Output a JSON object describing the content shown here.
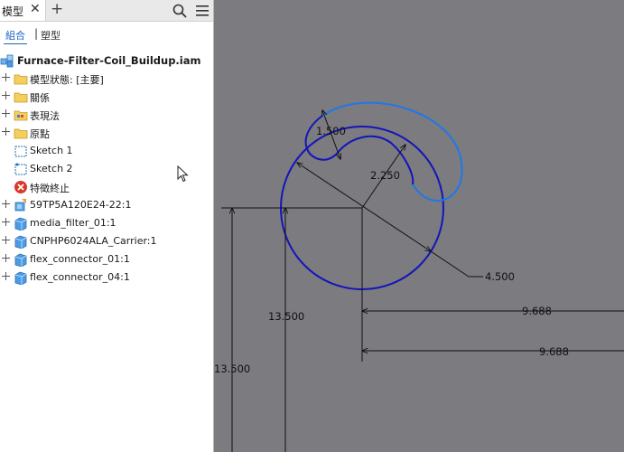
{
  "tabs": {
    "model_label": "模型",
    "close_glyph": "✕",
    "add_glyph": "+"
  },
  "icons": {
    "search": "search-icon",
    "menu": "hamburger-menu-icon",
    "assembly": "assembly-icon",
    "folder": "folder-icon",
    "sketch": "sketch-icon",
    "end_of_features": "end-of-features-icon",
    "part": "part-icon"
  },
  "subtabs": {
    "assembly": "組合",
    "separator": "|",
    "modeling": "塑型"
  },
  "tree": {
    "root": "Furnace-Filter-Coil_Buildup.iam",
    "items": [
      "模型狀態: [主要]",
      "關係",
      "表現法",
      "原點",
      "Sketch 1",
      "Sketch 2",
      "特徵終止",
      "59TP5A120E24-22:1",
      "media_filter_01:1",
      "CNPHP6024ALA_Carrier:1",
      "flex_connector_01:1",
      "flex_connector_04:1"
    ]
  },
  "dimensions": {
    "d1": "1.500",
    "d2": "2.250",
    "d3": "4.500",
    "d4": "9.688",
    "d5": "9.688",
    "d6": "13.500",
    "d7": "13.500"
  },
  "colors": {
    "canvas_bg": "#7b7b80",
    "sketch_dark": "#1515b8",
    "sketch_light": "#1f78e8",
    "dimension": "#111111",
    "accent": "#1a63c7"
  }
}
